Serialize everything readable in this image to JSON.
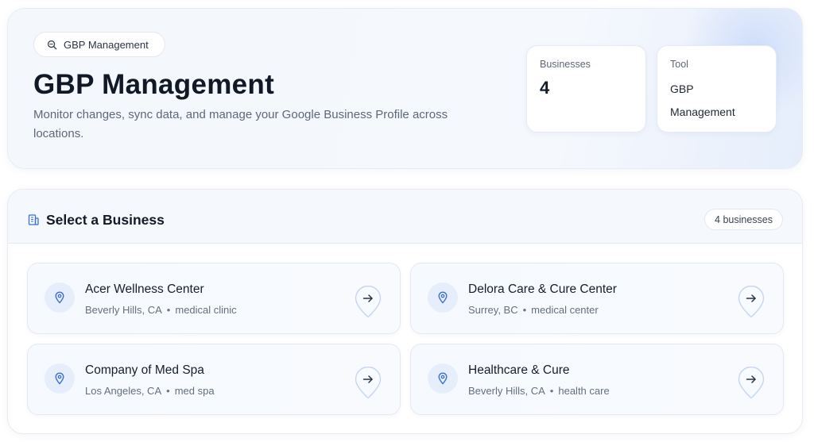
{
  "hero": {
    "pill_label": "GBP Management",
    "title": "GBP Management",
    "subtitle": "Monitor changes, sync data, and manage your Google Business Profile across locations."
  },
  "stats": {
    "businesses_label": "Businesses",
    "businesses_value": "4",
    "tool_label": "Tool",
    "tool_value": "GBP Management"
  },
  "panel": {
    "title": "Select a Business",
    "count_badge": "4 businesses"
  },
  "businesses": [
    {
      "name": "Acer Wellness Center",
      "location": "Beverly Hills, CA",
      "category": "medical clinic"
    },
    {
      "name": "Delora Care & Cure Center",
      "location": "Surrey, BC",
      "category": "medical center"
    },
    {
      "name": "Company of Med Spa",
      "location": "Los Angeles, CA",
      "category": "med spa"
    },
    {
      "name": "Healthcare & Cure",
      "location": "Beverly Hills, CA",
      "category": "health care"
    }
  ],
  "meta_separator": "•",
  "icons": {
    "pill": "search-icon",
    "panel": "building-icon",
    "card": "map-pin-icon",
    "action": "arrow-right-pin-icon"
  },
  "colors": {
    "accent": "#3b6fd1",
    "title": "#111826",
    "muted": "#5f6878"
  }
}
